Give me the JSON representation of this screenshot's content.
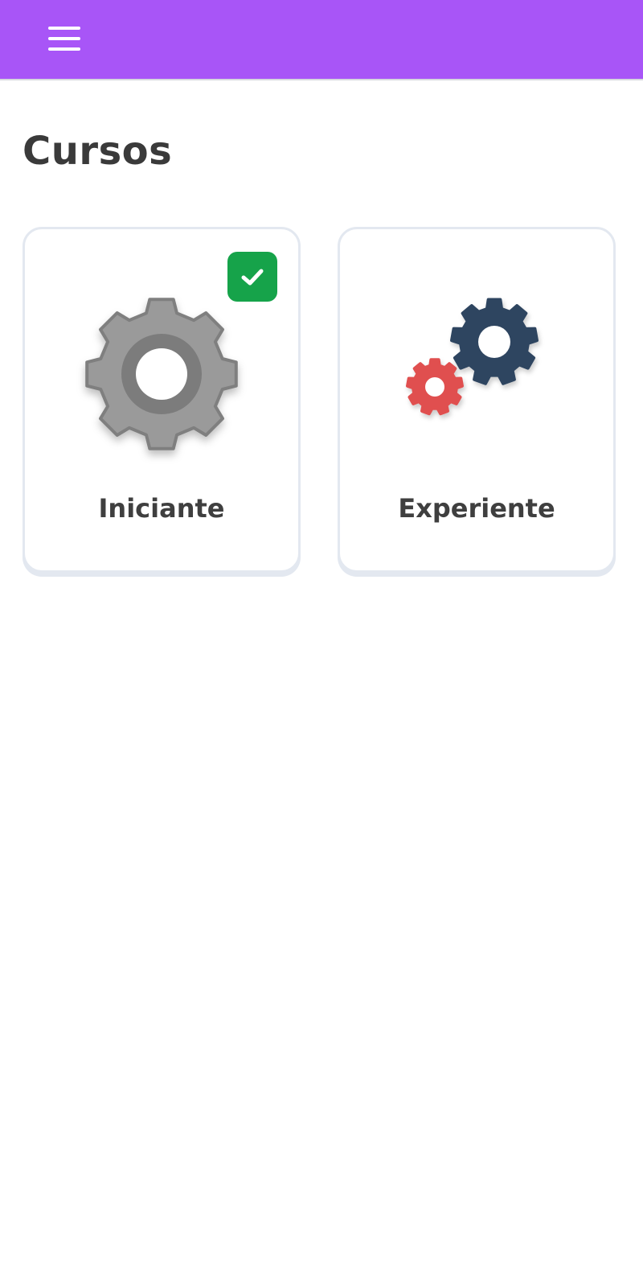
{
  "header": {
    "menu_icon": "hamburger-menu-icon",
    "background_color": "#a855f7"
  },
  "page": {
    "title": "Cursos"
  },
  "courses": [
    {
      "label": "Iniciante",
      "icon": "gear-icon",
      "completed": true,
      "badge_icon": "check-icon",
      "badge_color": "#16a34a"
    },
    {
      "label": "Experiente",
      "icon": "gears-icon",
      "completed": false
    }
  ]
}
